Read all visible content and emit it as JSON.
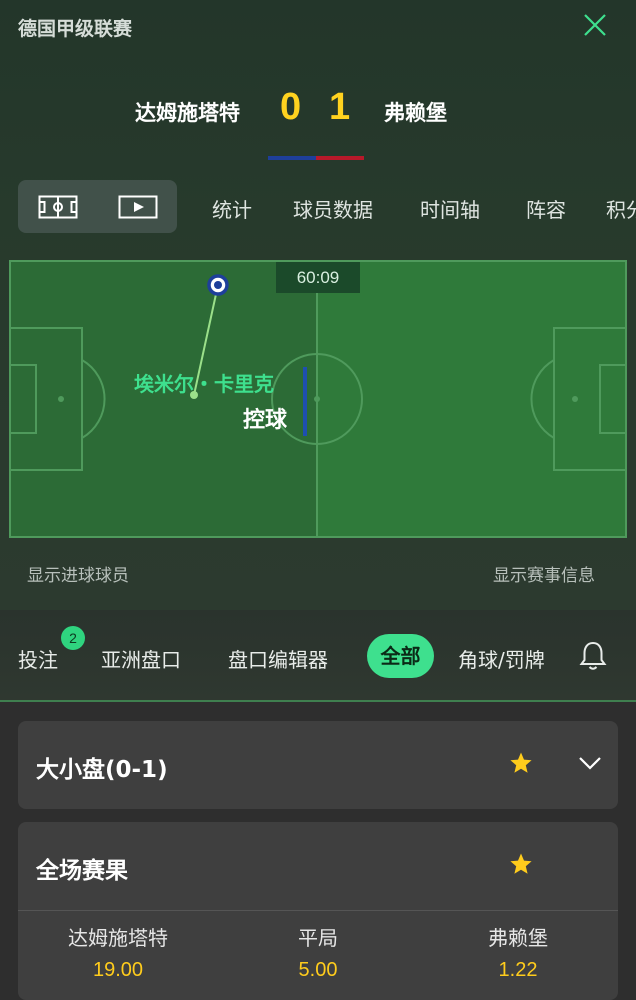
{
  "header": {
    "league": "德国甲级联赛",
    "close_icon": "close-icon"
  },
  "match": {
    "home_team": "达姆施塔特",
    "away_team": "弗赖堡",
    "home_score": "0",
    "away_score": "1",
    "home_color": "#1e3f9a",
    "away_color": "#b8192a"
  },
  "tabs": {
    "view_icons": [
      "field-icon",
      "video-icon"
    ],
    "items": [
      "统计",
      "球员数据",
      "时间轴",
      "阵容",
      "积分"
    ]
  },
  "pitch": {
    "timer": "60:09",
    "player_name": "埃米尔・卡里克",
    "event": "控球"
  },
  "links": {
    "show_scorers": "显示进球球员",
    "show_match_info": "显示赛事信息"
  },
  "bet_nav": {
    "items": [
      "投注",
      "亚洲盘口",
      "盘口编辑器",
      "全部",
      "角球/罚牌"
    ],
    "badge": "2",
    "active": "全部",
    "accent": "#3ee08e"
  },
  "markets": [
    {
      "title": "大小盘(0-1)",
      "starred": true
    },
    {
      "title": "全场赛果",
      "starred": true,
      "odds": [
        {
          "name": "达姆施塔特",
          "value": "19.00"
        },
        {
          "name": "平局",
          "value": "5.00"
        },
        {
          "name": "弗赖堡",
          "value": "1.22"
        }
      ]
    }
  ]
}
